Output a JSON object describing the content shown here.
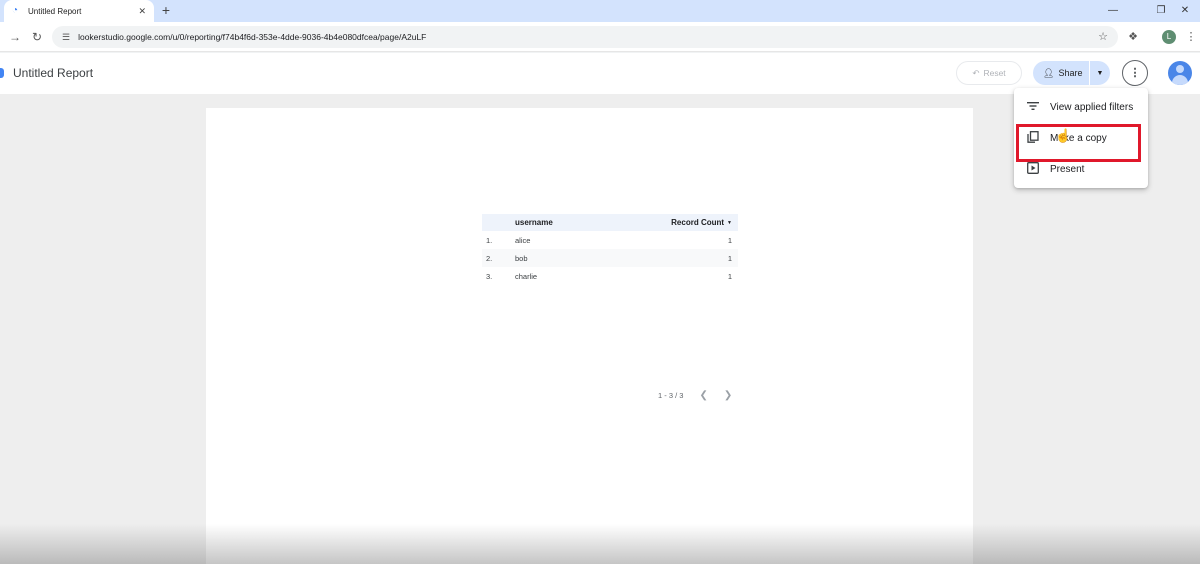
{
  "browser": {
    "tab_title": "Untitled Report",
    "new_tab": "+",
    "url": "lookerstudio.google.com/u/0/reporting/f74b4f6d-353e-4dde-9036-4b4e080dfcea/page/A2uLF",
    "profile_initial": "L"
  },
  "header": {
    "report_title": "Untitled Report",
    "reset_label": "Reset",
    "share_label": "Share"
  },
  "table": {
    "columns": [
      "username",
      "Record Count"
    ],
    "rows": [
      {
        "index": "1.",
        "username": "alice",
        "count": "1"
      },
      {
        "index": "2.",
        "username": "bob",
        "count": "1"
      },
      {
        "index": "3.",
        "username": "charlie",
        "count": "1"
      }
    ],
    "pagination": "1 - 3 / 3"
  },
  "menu": {
    "items": [
      {
        "label": "View applied filters",
        "icon": "filter-icon"
      },
      {
        "label": "Make a copy",
        "icon": "copy-icon"
      },
      {
        "label": "Present",
        "icon": "present-icon"
      }
    ]
  },
  "colors": {
    "tabstrip": "#d3e3fd",
    "share_button": "#d3e3fd",
    "highlight_box": "#e0182b"
  }
}
